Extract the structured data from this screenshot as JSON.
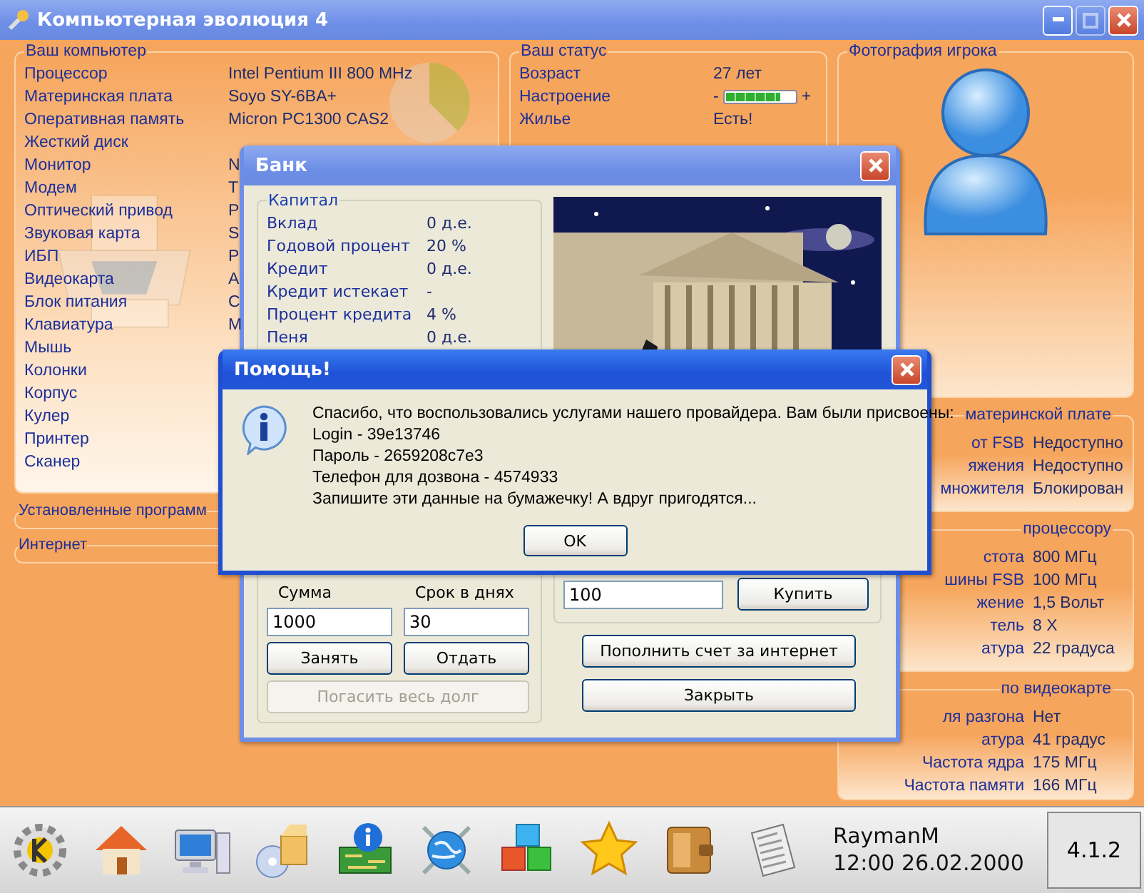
{
  "window": {
    "title": "Компьютерная эволюция 4"
  },
  "computer_panel": {
    "title": "Ваш компьютер",
    "rows": [
      {
        "label": "Процессор",
        "value": "Intel Pentium III 800 MHz"
      },
      {
        "label": "Материнская плата",
        "value": "Soyo SY-6BA+"
      },
      {
        "label": "Оперативная память",
        "value": "Micron PC1300 CAS2"
      },
      {
        "label": "Жесткий диск"
      },
      {
        "label": "Монитор",
        "value": "N"
      },
      {
        "label": "Модем",
        "value": "T"
      },
      {
        "label": "Оптический привод",
        "value": "P"
      },
      {
        "label": "Звуковая карта",
        "value": "S"
      },
      {
        "label": "ИБП",
        "value": "P"
      },
      {
        "label": "Видеокарта",
        "value": "A"
      },
      {
        "label": "Блок питания",
        "value": "C"
      },
      {
        "label": "Клавиатура",
        "value": "M"
      },
      {
        "label": "Мышь"
      },
      {
        "label": "Колонки"
      },
      {
        "label": "Корпус"
      },
      {
        "label": "Кулер"
      },
      {
        "label": "Принтер"
      },
      {
        "label": "Сканер"
      }
    ]
  },
  "collapsed_panels": [
    {
      "title": "Установленные программ"
    },
    {
      "title": "Интернет"
    }
  ],
  "status_panel": {
    "title": "Ваш статус",
    "rows": [
      {
        "kind": "text",
        "label": "Возраст",
        "value": "27 лет"
      },
      {
        "kind": "meter",
        "label": "Настроение",
        "minus": "-",
        "plus": "+",
        "level": 0.8
      },
      {
        "kind": "text",
        "label": "Жилье",
        "value": "Есть!"
      }
    ]
  },
  "photo_panel": {
    "title": "Фотография игрока"
  },
  "info_panels": [
    {
      "title": "материнской плате",
      "rows": [
        {
          "label": "от FSB",
          "value": "Недоступно"
        },
        {
          "label": "яжения",
          "value": "Недоступно"
        },
        {
          "label": "множителя",
          "value": "Блокирован"
        }
      ]
    },
    {
      "title": "процессору",
      "rows": [
        {
          "label": "стота",
          "value": "800 МГц"
        },
        {
          "label": "шины FSB",
          "value": "100 МГц"
        },
        {
          "label": "жение",
          "value": "1,5 Вольт"
        },
        {
          "label": "тель",
          "value": "8 X"
        },
        {
          "label": "атура",
          "value": "22 градуса"
        }
      ]
    },
    {
      "title": "по видеокарте",
      "rows": [
        {
          "label": "ля разгона",
          "value": "Нет"
        },
        {
          "label": "атура",
          "value": "41 градус"
        },
        {
          "label": "Частота ядра",
          "value": "175 МГц"
        },
        {
          "label": "Частота памяти",
          "value": "166 МГц"
        }
      ]
    }
  ],
  "bank": {
    "title": "Банк",
    "capital": {
      "title": "Капитал",
      "rows": [
        {
          "label": "Вклад",
          "value": "0 д.е."
        },
        {
          "label": "Годовой процент",
          "value": "20 %"
        },
        {
          "label": "Кредит",
          "value": "0 д.е."
        },
        {
          "label": "Кредит истекает",
          "value": "-"
        },
        {
          "label": "Процент кредита",
          "value": "4 %"
        },
        {
          "label": "Пеня",
          "value": "0 д.е."
        }
      ]
    },
    "loan": {
      "amount_label": "Сумма",
      "amount": "1000",
      "days_label": "Срок в днях",
      "days": "30",
      "borrow": "Занять",
      "repay": "Отдать",
      "repay_all": {
        "label": "Погасить весь долг",
        "disabled": true
      }
    },
    "buy": {
      "amount": "100",
      "button": "Купить"
    },
    "topup": "Пополнить счет за интернет",
    "close": "Закрыть"
  },
  "help": {
    "title": "Помощь!",
    "lines": [
      "Спасибо, что воспользовались услугами нашего провайдера. Вам были присвоены:",
      "Login - 39e13746",
      "Пароль - 2659208c7e3",
      "Телефон для дозвона - 4574933",
      "Запишите эти данные на бумажечку! А вдруг пригодятся..."
    ],
    "ok": "OK"
  },
  "taskbar": {
    "user": "RaymanM",
    "datetime": "12:00 26.02.2000",
    "version": "4.1.2"
  }
}
